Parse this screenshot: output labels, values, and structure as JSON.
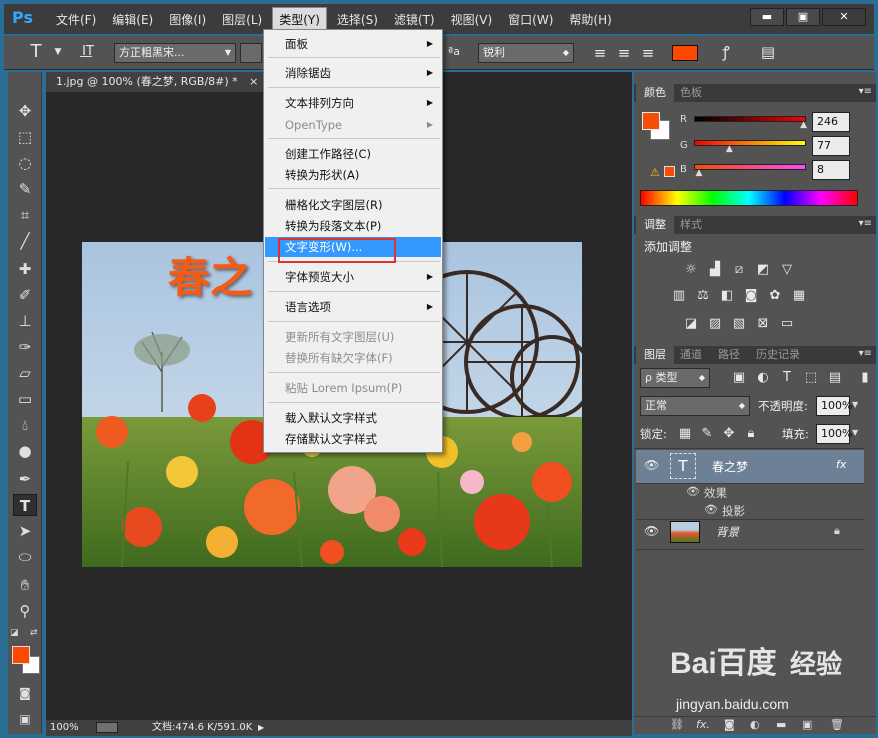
{
  "app": {
    "logo": "Ps",
    "menu": [
      "文件(F)",
      "编辑(E)",
      "图像(I)",
      "图层(L)",
      "类型(Y)",
      "选择(S)",
      "滤镜(T)",
      "视图(V)",
      "窗口(W)",
      "帮助(H)"
    ],
    "window_controls": [
      "minimize-icon",
      "restore-icon",
      "close-icon"
    ]
  },
  "options_bar": {
    "tool_glyph": "T",
    "orient_glyph": "I͟T",
    "font_family": "方正粗黑宋...",
    "aa_label": "ªa",
    "anti_alias": "锐利",
    "text_color": "#ff4800"
  },
  "document": {
    "tab_title": "1.jpg @ 100% (春之梦, RGB/8#) *",
    "close_glyph": "×",
    "overlay_text": "春之",
    "zoom": "100%",
    "doc_size": "文档:474.6 K/591.0K"
  },
  "type_menu": {
    "items": [
      {
        "label": "面板",
        "submenu": true,
        "disabled": false
      },
      {
        "label": "消除锯齿",
        "submenu": true,
        "disabled": false
      },
      {
        "label": "文本排列方向",
        "submenu": true,
        "disabled": false
      },
      {
        "label": "OpenType",
        "submenu": true,
        "disabled": true
      },
      {
        "label": "创建工作路径(C)",
        "submenu": false,
        "disabled": false
      },
      {
        "label": "转换为形状(A)",
        "submenu": false,
        "disabled": false
      },
      {
        "label": "栅格化文字图层(R)",
        "submenu": false,
        "disabled": false
      },
      {
        "label": "转换为段落文本(P)",
        "submenu": false,
        "disabled": false
      },
      {
        "label": "文字变形(W)...",
        "submenu": false,
        "disabled": false,
        "highlighted": true
      },
      {
        "label": "字体预览大小",
        "submenu": true,
        "disabled": false
      },
      {
        "label": "语言选项",
        "submenu": true,
        "disabled": false
      },
      {
        "label": "更新所有文字图层(U)",
        "submenu": false,
        "disabled": true
      },
      {
        "label": "替换所有缺欠字体(F)",
        "submenu": false,
        "disabled": true
      },
      {
        "label": "粘贴 Lorem Ipsum(P)",
        "submenu": false,
        "disabled": true
      },
      {
        "label": "载入默认文字样式",
        "submenu": false,
        "disabled": false
      },
      {
        "label": "存储默认文字样式",
        "submenu": false,
        "disabled": false
      }
    ]
  },
  "color_panel": {
    "tabs": [
      "颜色",
      "色板"
    ],
    "r_label": "R",
    "r": "246",
    "g_label": "G",
    "g": "77",
    "b_label": "B",
    "b": "8",
    "r_fraction": 0.965,
    "g_fraction": 0.302,
    "b_fraction": 0.031,
    "foreground": "#f64d08",
    "warning_glyph": "⚠"
  },
  "adjustments_panel": {
    "tabs": [
      "调整",
      "样式"
    ],
    "title": "添加调整"
  },
  "layers_panel": {
    "tabs": [
      "图层",
      "通道",
      "路径",
      "历史记录"
    ],
    "filter": "ρ 类型",
    "blend_mode": "正常",
    "opacity_label": "不透明度:",
    "opacity": "100%",
    "lock_label": "锁定:",
    "fill_label": "填充:",
    "fill": "100%",
    "layers": [
      {
        "name": "春之梦",
        "type": "text",
        "fx": "fx",
        "selected": true
      },
      {
        "name": "背景",
        "type": "image",
        "locked": true
      }
    ],
    "effects_label": "效果",
    "drop_shadow_label": "投影"
  },
  "watermark": {
    "brand": "Bai百度",
    "sub": "经验",
    "url": "jingyan.baidu.com"
  },
  "colors": {
    "accent": "#3399ff",
    "highlight_box": "#e03030",
    "text_orange": "#f65a14"
  }
}
